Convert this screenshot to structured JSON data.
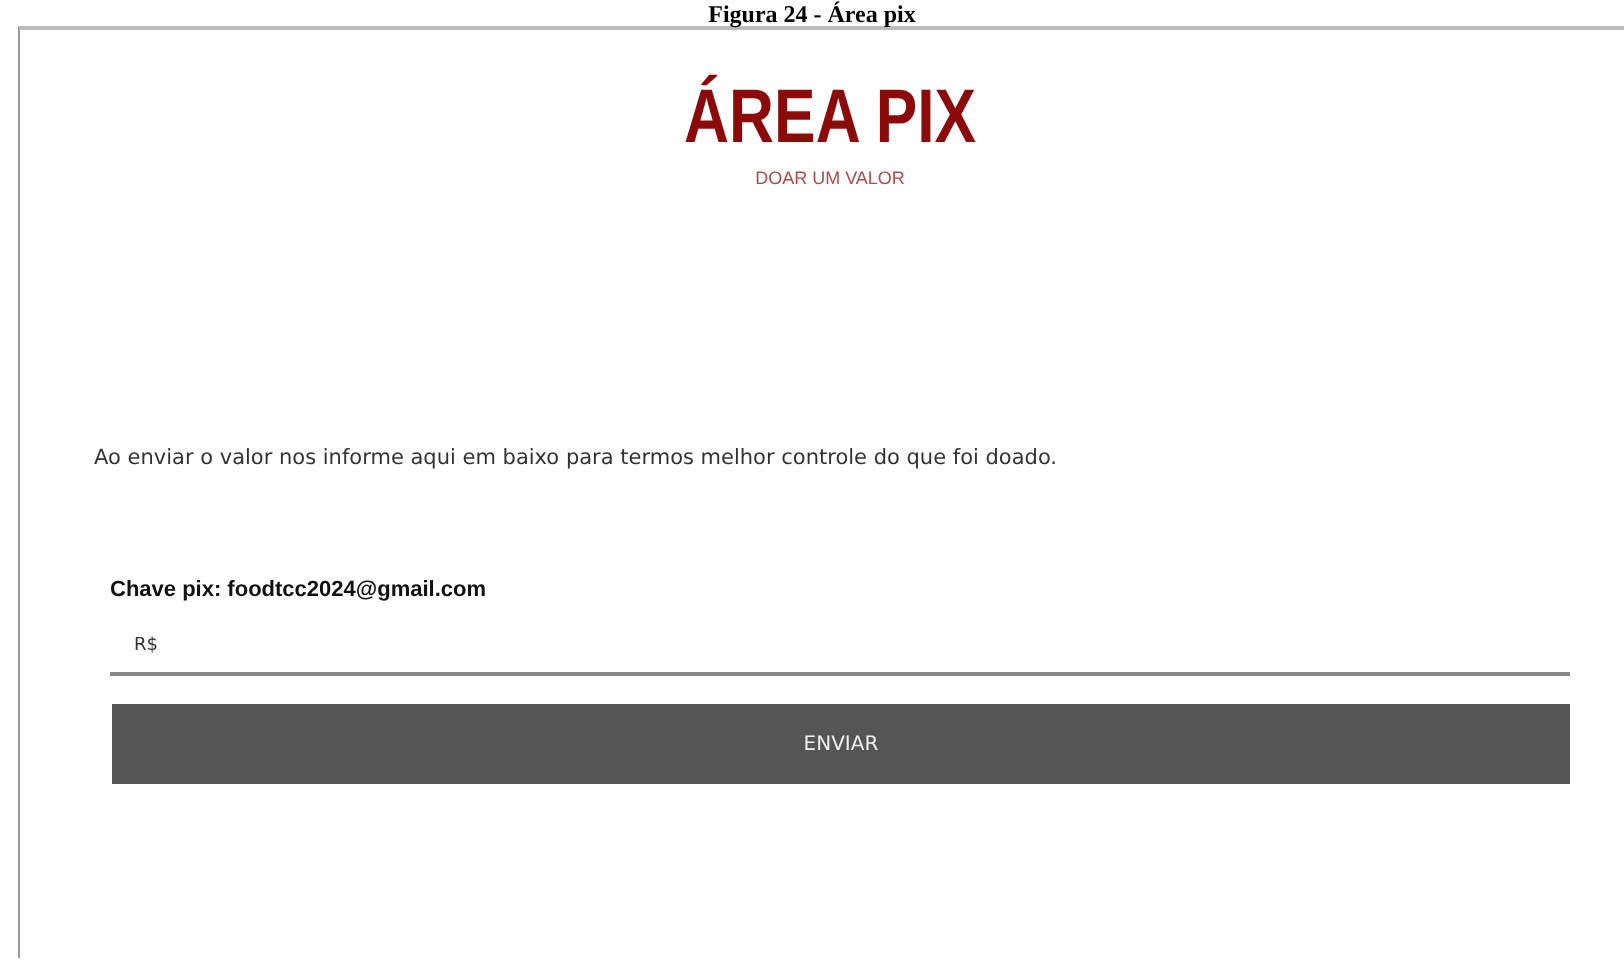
{
  "caption": "Figura 24 - Área pix",
  "header": {
    "title": "ÁREA PIX",
    "subtitle": "DOAR UM VALOR"
  },
  "instructions": "Ao enviar o valor nos informe aqui em baixo para termos melhor controle do que foi doado.",
  "form": {
    "pix_key": "Chave pix: foodtcc2024@gmail.com",
    "amount": {
      "placeholder": "R$"
    },
    "submit": "ENVIAR"
  }
}
